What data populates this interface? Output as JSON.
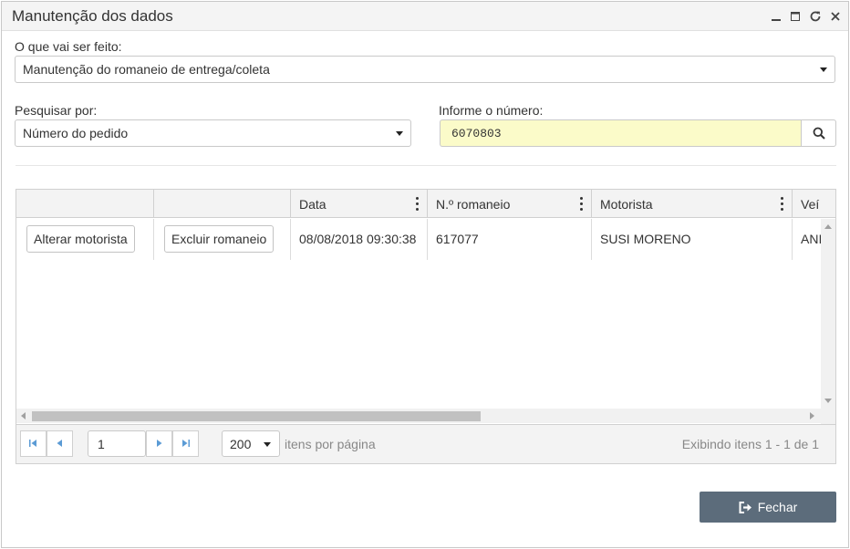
{
  "window": {
    "title": "Manutenção dos dados",
    "controls": [
      "minimize-icon",
      "maximize-icon",
      "refresh-icon",
      "close-icon"
    ]
  },
  "form": {
    "action_label": "O que vai ser feito:",
    "action_value": "Manutenção do romaneio de entrega/coleta",
    "search_by_label": "Pesquisar por:",
    "search_by_value": "Número do pedido",
    "number_label": "Informe o número:",
    "number_value": "6070803",
    "search_icon": "search-icon"
  },
  "grid": {
    "columns": [
      "",
      "",
      "Data",
      "N.º romaneio",
      "Motorista",
      "Veí"
    ],
    "rows": [
      {
        "action1": "Alterar motorista",
        "action2": "Excluir romaneio",
        "data": "08/08/2018 09:30:38",
        "romaneio": "617077",
        "motorista": "SUSI MORENO",
        "veiculo": "ANI"
      }
    ]
  },
  "pager": {
    "page": "1",
    "per_page": "200",
    "per_page_label": "itens por página",
    "info": "Exibindo itens 1 - 1 de 1"
  },
  "footer": {
    "close_label": "Fechar"
  },
  "colors": {
    "input_highlight": "#fbfbc9",
    "close_button": "#5c6c7b"
  }
}
